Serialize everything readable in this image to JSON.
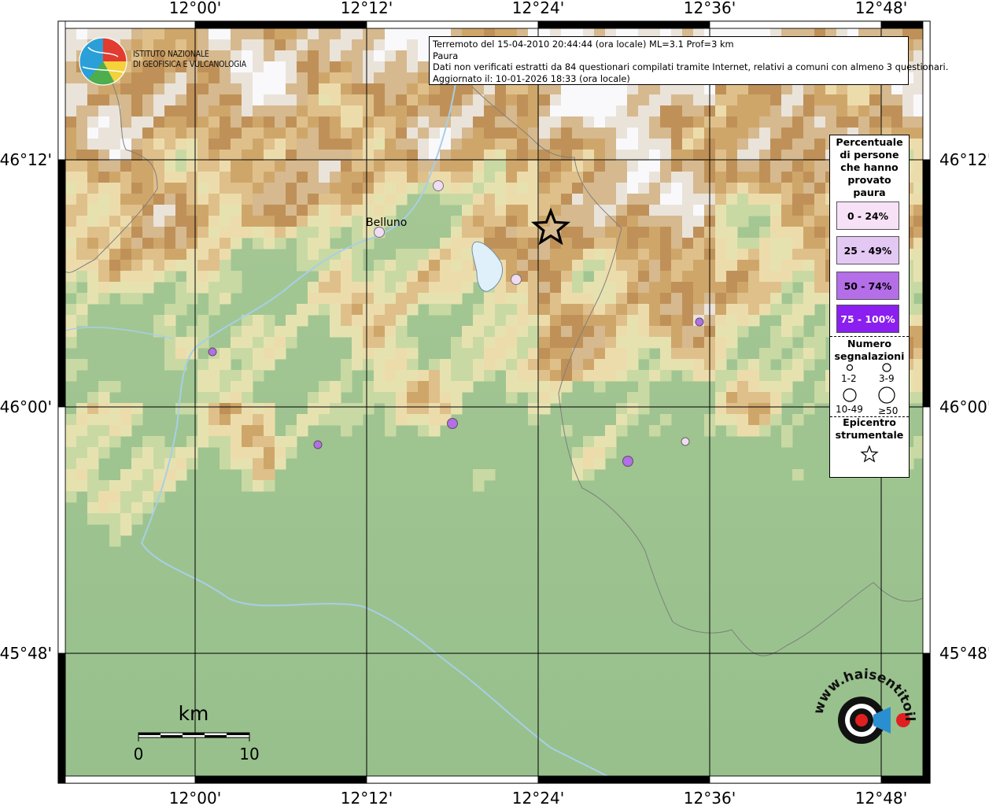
{
  "info": {
    "line1": "Terremoto del 15-04-2010 20:44:44 (ora locale) ML=3.1 Prof=3 km",
    "line2": "Paura",
    "line3": "Dati non verificati estratti da 84 questionari compilati tramite Internet, relativi a comuni con almeno 3 questionari.",
    "line4": "Aggiornato il: 10-01-2026 18:33 (ora locale)"
  },
  "logo": {
    "line1": "ISTITUTO NAZIONALE",
    "line2": "DI GEOFISICA E VULCANOLOGIA"
  },
  "axes": {
    "top": [
      "12°00'",
      "12°12'",
      "12°24'",
      "12°36'",
      "12°48'"
    ],
    "bottom": [
      "12°00'",
      "12°12'",
      "12°24'",
      "12°36'",
      "12°48'"
    ],
    "left": [
      "46°12'",
      "46°00'",
      "45°48'"
    ],
    "right": [
      "46°12'",
      "46°00'",
      "45°48'"
    ]
  },
  "places": [
    {
      "name": "Belluno"
    }
  ],
  "legend": {
    "title": [
      "Percentuale",
      "di persone",
      "che hanno",
      "provato",
      "paura"
    ],
    "classes": [
      {
        "label": "0 - 24%",
        "color": "#f7e1f7"
      },
      {
        "label": "25 - 49%",
        "color": "#e4c8f4"
      },
      {
        "label": "50 - 74%",
        "color": "#b46ee8"
      },
      {
        "label": "75 - 100%",
        "color": "#8a1ff0"
      }
    ],
    "count_title": [
      "Numero",
      "segnalazioni"
    ],
    "count_classes": [
      "1-2",
      "3-9",
      "10-49",
      "≥50"
    ],
    "epicenter_title": [
      "Epicentro",
      "strumentale"
    ]
  },
  "scalebar": {
    "unit": "km",
    "start": "0",
    "end": "10"
  },
  "watermark": {
    "text": "www.haisentitoilterremoto.it"
  },
  "colors": {
    "grid": "#000000",
    "river": "#a7cfe6",
    "lake": "#e0f0fa",
    "border": "#7f7f7f"
  }
}
